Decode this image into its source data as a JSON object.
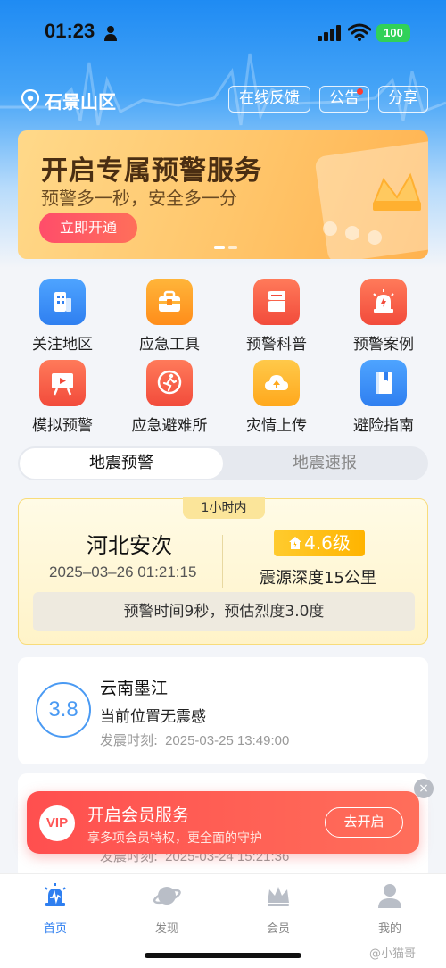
{
  "status_bar": {
    "time": "01:23",
    "battery": "100"
  },
  "header": {
    "location": "石景山区",
    "feedback": "在线反馈",
    "notice": "公告",
    "share": "分享"
  },
  "banner": {
    "title": "开启专属预警服务",
    "subtitle": "预警多一秒，安全多一分",
    "button": "立即开通"
  },
  "tools": [
    {
      "label": "关注地区",
      "icon": "building-icon"
    },
    {
      "label": "应急工具",
      "icon": "toolbox-icon"
    },
    {
      "label": "预警科普",
      "icon": "book-icon"
    },
    {
      "label": "预警案例",
      "icon": "alarm-icon"
    },
    {
      "label": "模拟预警",
      "icon": "presentation-icon"
    },
    {
      "label": "应急避难所",
      "icon": "running-person-icon"
    },
    {
      "label": "灾情上传",
      "icon": "cloud-upload-icon"
    },
    {
      "label": "避险指南",
      "icon": "guide-book-icon"
    }
  ],
  "tabs": {
    "active": "地震预警",
    "inactive": "地震速报"
  },
  "featured_quake": {
    "pill": "1小时内",
    "place": "河北安次",
    "time": "2025–03–26 01:21:15",
    "magnitude": "4.6级",
    "depth": "震源深度15公里",
    "warning": "预警时间9秒，预估烈度3.0度"
  },
  "quakes": [
    {
      "magnitude": "3.8",
      "place": "云南墨江",
      "status": "当前位置无震感",
      "time_label": "发震时刻:",
      "time": "2025-03-25 13:49:00"
    },
    {
      "magnitude": "",
      "place": "",
      "status": "",
      "time_label": "发震时刻:",
      "time": "2025-03-24 15:21:36"
    }
  ],
  "vip": {
    "badge": "VIP",
    "title": "开启会员服务",
    "subtitle": "享多项会员特权，更全面的守护",
    "button": "去开启",
    "close": "×"
  },
  "bottom_nav": [
    {
      "label": "首页",
      "icon": "home-icon"
    },
    {
      "label": "发现",
      "icon": "planet-icon"
    },
    {
      "label": "会员",
      "icon": "crown-icon"
    },
    {
      "label": "我的",
      "icon": "profile-icon"
    }
  ],
  "watermark": "@小猫哥"
}
